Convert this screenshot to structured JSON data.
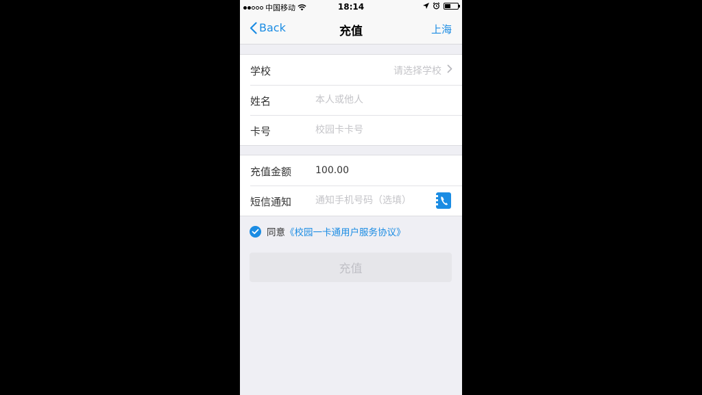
{
  "status_bar": {
    "carrier": "中国移动",
    "time": "18:14"
  },
  "nav": {
    "back_label": "Back",
    "title": "充值",
    "city": "上海"
  },
  "form": {
    "school": {
      "label": "学校",
      "value": "请选择学校"
    },
    "name": {
      "label": "姓名",
      "placeholder": "本人或他人"
    },
    "card": {
      "label": "卡号",
      "placeholder": "校园卡卡号"
    },
    "amount": {
      "label": "充值金额",
      "value": "100.00"
    },
    "sms": {
      "label": "短信通知",
      "placeholder": "通知手机号码（选填）"
    }
  },
  "agreement": {
    "prefix": "同意",
    "link": "《校园一卡通用户服务协议》",
    "checked": true
  },
  "submit_label": "充值",
  "colors": {
    "accent": "#1b8ce3",
    "background": "#efeff4",
    "disabled_button": "#e6e6ea"
  }
}
